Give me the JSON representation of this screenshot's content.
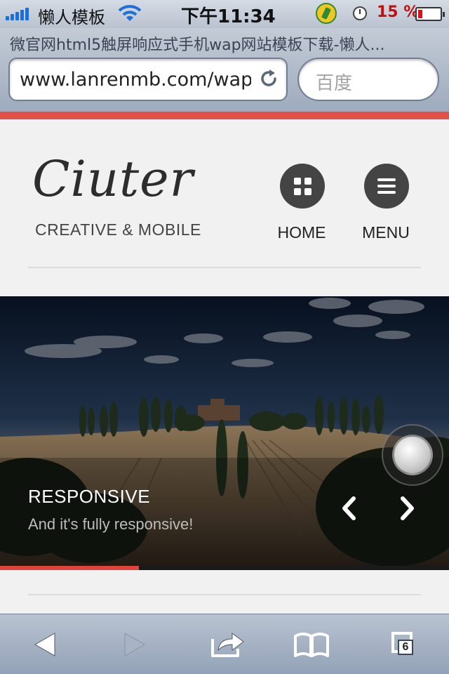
{
  "status_bar": {
    "carrier": "懒人模板",
    "time": "下午11:34",
    "battery_percent": "15 %",
    "battery_level": 0.15,
    "icons": [
      "signal-icon",
      "wifi-icon",
      "app-icon",
      "alarm-icon",
      "battery-icon"
    ]
  },
  "browser": {
    "page_title": "微官网html5触屏响应式手机wap网站模板下载-懒人...",
    "url": "www.lanrenmb.com/wap",
    "search_placeholder": "百度"
  },
  "site": {
    "logo": "Ciuter",
    "tagline": "CREATIVE & MOBILE",
    "nav": {
      "home_label": "HOME",
      "menu_label": "MENU"
    }
  },
  "slider": {
    "title": "RESPONSIVE",
    "caption": "And it's fully responsive!",
    "progress": 0.31
  },
  "toolbar": {
    "tab_count": "6",
    "icons": [
      "back-icon",
      "forward-icon",
      "share-icon",
      "bookmarks-icon",
      "tabs-icon"
    ]
  },
  "colors": {
    "accent": "#e25149",
    "nav_button": "#444444",
    "page_background": "#f1f1f1"
  }
}
